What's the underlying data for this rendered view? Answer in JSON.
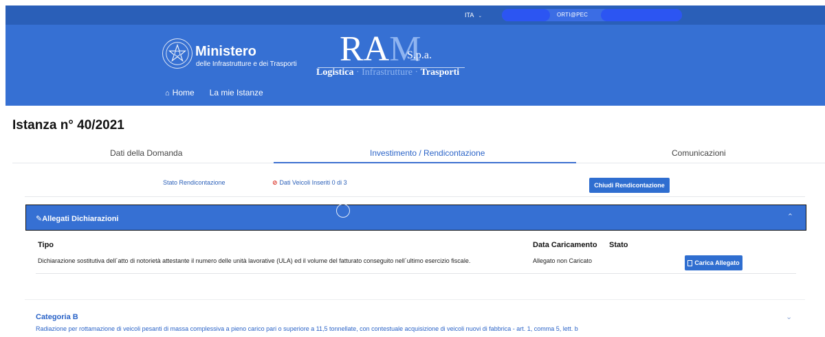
{
  "topbar": {
    "language": "ITA",
    "user_email": "ORTI@PEC"
  },
  "header": {
    "ministry_title": "Ministero",
    "ministry_subtitle": "delle Infrastrutture e dei Trasporti",
    "ram_logo": {
      "part1": "RA",
      "part2": "M",
      "spa": "S.p.a.",
      "tag_left": "Logistica",
      "tag_mid": "Infrastrutture",
      "tag_right": "Trasporti",
      "separator": " · "
    },
    "nav": {
      "home": "Home",
      "instances": "La mie Istanze"
    }
  },
  "page": {
    "title": "Istanza n° 40/2021"
  },
  "tabs": [
    {
      "label": "Dati della Domanda",
      "active": false
    },
    {
      "label": "Investimento / Rendicontazione",
      "active": true
    },
    {
      "label": "Comunicazioni",
      "active": false
    }
  ],
  "status": {
    "label": "Stato Rendicontazione",
    "value": "Dati Veicoli Inseriti 0 di 3",
    "close_button": "Chiudi Rendicontazione"
  },
  "allegati": {
    "title": "Allegati Dichiarazioni",
    "columns": {
      "tipo": "Tipo",
      "data": "Data Caricamento",
      "stato": "Stato"
    },
    "rows": [
      {
        "tipo": "Dichiarazione sostitutiva dell´atto di notorietà attestante il numero delle unità lavorative (ULA) ed il volume del fatturato conseguito nell´ultimo esercizio fiscale.",
        "data": "Allegato non Caricato",
        "action": "Carica Allegato"
      }
    ]
  },
  "categoria": {
    "title": "Categoria B",
    "description": "Radiazione per rottamazione di veicoli pesanti di massa complessiva a pieno carico pari o superiore a 11,5 tonnellate, con contestuale acquisizione di veicoli nuovi di fabbrica - art. 1, comma 5, lett. b"
  },
  "colors": {
    "primary": "#3670d3",
    "topbar": "#2a5fb8",
    "link": "#2a63c7",
    "error": "#d93025"
  }
}
